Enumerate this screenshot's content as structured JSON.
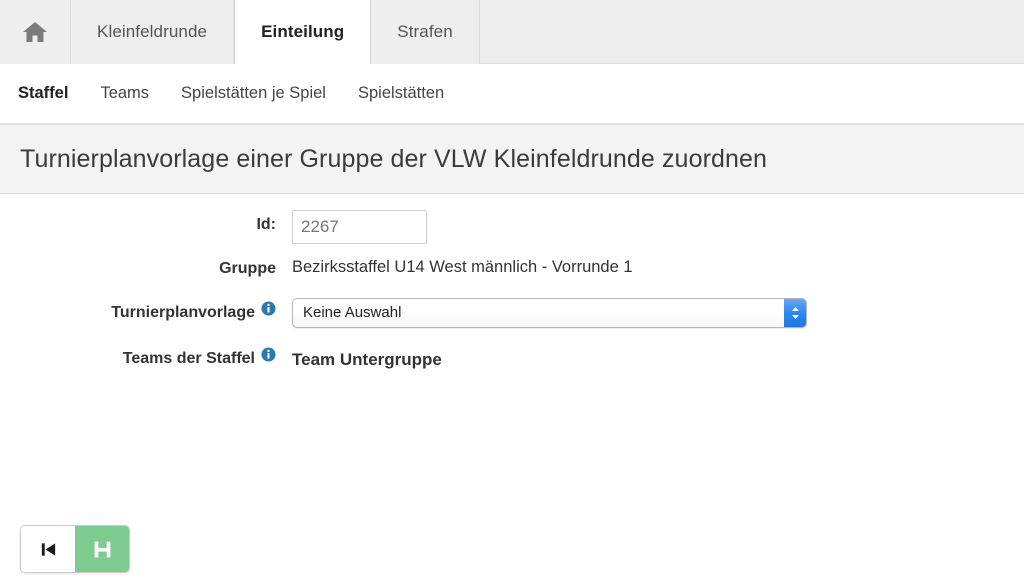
{
  "tabs": {
    "home_icon": "home-icon",
    "items": [
      {
        "label": "Kleinfeldrunde",
        "active": false
      },
      {
        "label": "Einteilung",
        "active": true
      },
      {
        "label": "Strafen",
        "active": false
      }
    ]
  },
  "subnav": {
    "items": [
      {
        "label": "Staffel",
        "active": true
      },
      {
        "label": "Teams",
        "active": false
      },
      {
        "label": "Spielstätten je Spiel",
        "active": false
      },
      {
        "label": "Spielstätten",
        "active": false
      }
    ]
  },
  "page": {
    "title": "Turnierplanvorlage einer Gruppe der VLW Kleinfeldrunde zuordnen"
  },
  "form": {
    "id": {
      "label": "Id:",
      "value": "2267"
    },
    "gruppe": {
      "label": "Gruppe",
      "value": "Bezirksstaffel U14 West männlich - Vorrunde 1"
    },
    "turnierplanvorlage": {
      "label": "Turnierplanvorlage",
      "info_icon": "info-icon",
      "selected": "Keine Auswahl",
      "options": [
        "Keine Auswahl"
      ]
    },
    "teams_der_staffel": {
      "label": "Teams der Staffel",
      "info_icon": "info-icon",
      "table_header": "Team Untergruppe"
    }
  },
  "actions": {
    "back": {
      "name": "back-button",
      "icon": "step-backward-icon"
    },
    "save": {
      "name": "save-button",
      "icon": "floppy-disk-icon",
      "color": "#7ecb8f"
    }
  },
  "colors": {
    "tabbar_bg": "#eeeeee",
    "title_band_bg": "#f3f3f3",
    "info_blue": "#2a7aad",
    "select_arrow_blue": "#2f86ee",
    "save_green": "#7ecb8f"
  }
}
